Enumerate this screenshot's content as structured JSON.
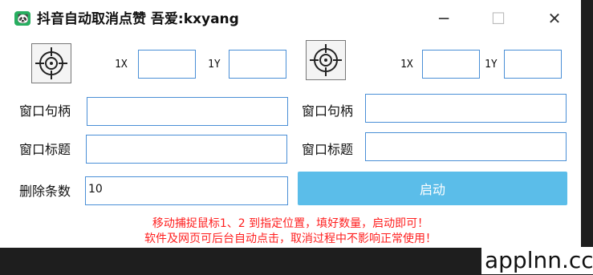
{
  "window": {
    "title": "抖音自动取消点赞    吾爱:kxyang",
    "icon": "panda-app-icon",
    "controls": {
      "minimize": "─",
      "maximize": "☐",
      "close": "✕"
    }
  },
  "left_panel": {
    "x_label": "1X",
    "y_label": "1Y",
    "x_value": "",
    "y_value": "",
    "handle_label": "窗口句柄",
    "handle_value": "",
    "title_label": "窗口标题",
    "title_value": "",
    "delete_count_label": "删除条数",
    "delete_count_value": "10"
  },
  "right_panel": {
    "x_label": "1X",
    "y_label": "1Y",
    "x_value": "",
    "y_value": "",
    "handle_label": "窗口句柄",
    "handle_value": "",
    "title_label": "窗口标题",
    "title_value": ""
  },
  "start_button": {
    "label": "启动"
  },
  "hints": [
    "移动捕捉鼠标1、2 到指定位置，填好数量，启动即可！",
    "软件及网页可后台自动点击，取消过程中不影响正常使用！"
  ],
  "watermark": "applnn.cc",
  "colors": {
    "accent": "#5bbde9",
    "input_border": "#4a8fd6",
    "hint": "#ff1f1f"
  }
}
